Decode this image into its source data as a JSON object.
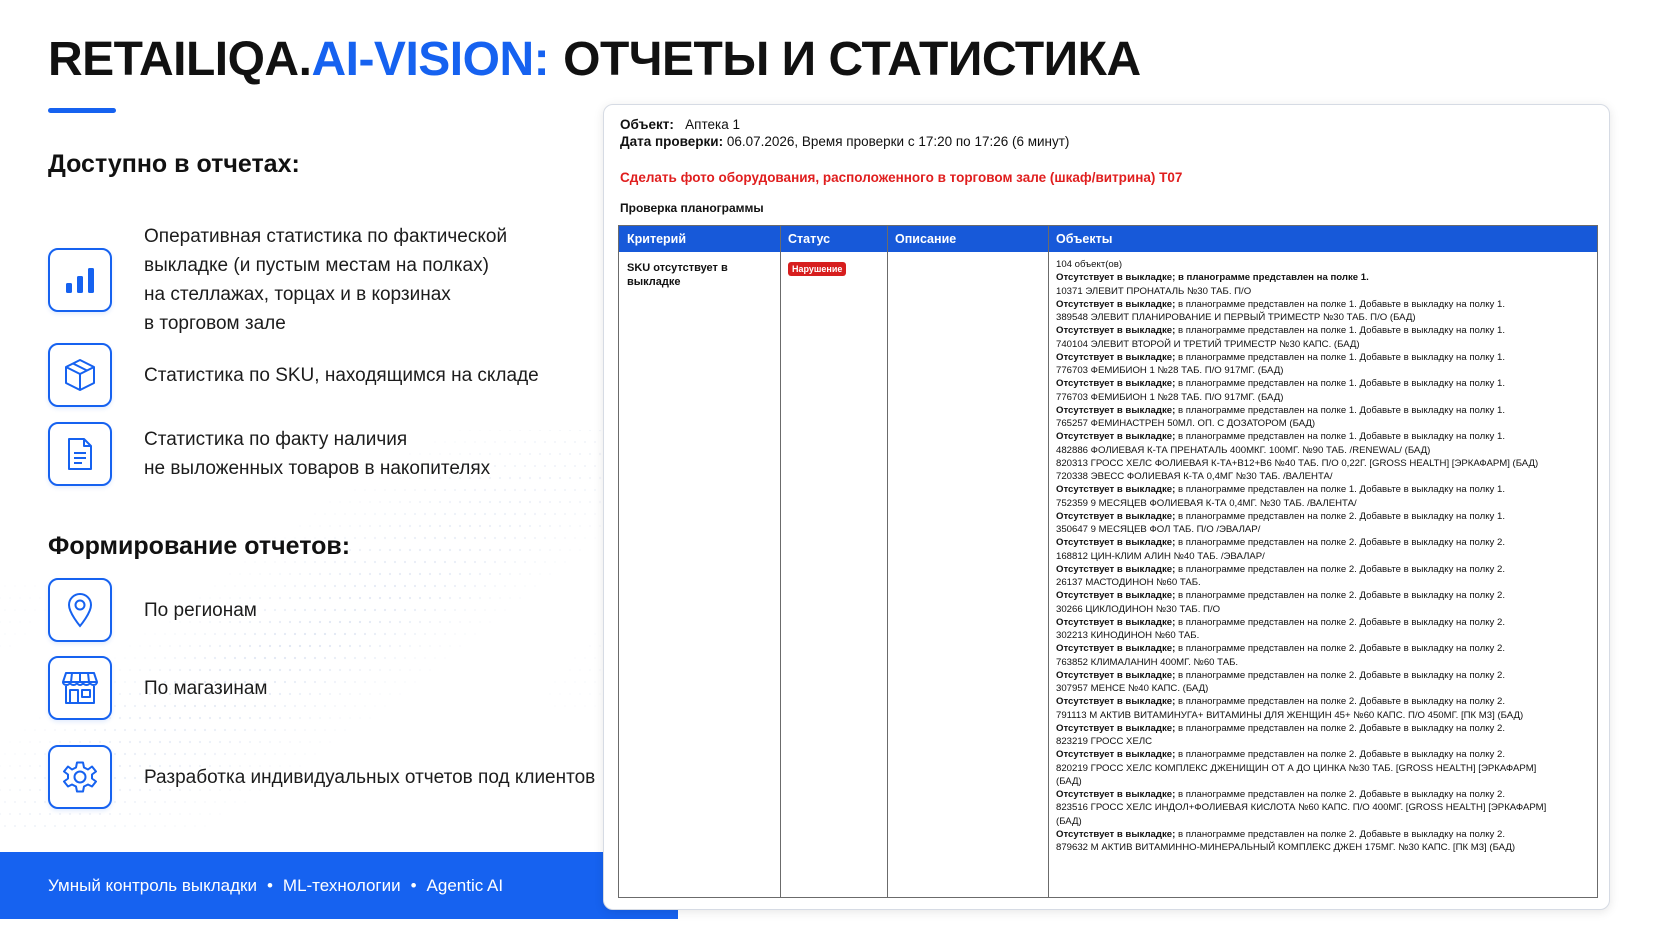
{
  "header": {
    "brand": "RETAILIQA.",
    "accent": "AI-VISION:",
    "rest": "ОТЧЕТЫ И СТАТИСТИКА"
  },
  "available": {
    "heading": "Доступно в отчетах:",
    "items": [
      {
        "icon": "bar-chart-icon",
        "lines": [
          "Оперативная статистика по фактической",
          "выкладке (и пустым местам на полках)",
          "на стеллажах, торцах и в корзинах",
          "в торговом зале"
        ]
      },
      {
        "icon": "box-icon",
        "lines": [
          "Статистика по SKU, находящимся на складе"
        ]
      },
      {
        "icon": "document-icon",
        "lines": [
          "Статистика по факту наличия",
          "не выложенных товаров в накопителях"
        ]
      }
    ]
  },
  "formation": {
    "heading": "Формирование отчетов:",
    "items": [
      {
        "icon": "location-pin-icon",
        "label": "По регионам"
      },
      {
        "icon": "store-icon",
        "label": "По магазинам"
      },
      {
        "icon": "gear-icon",
        "label": "Разработка индивидуальных отчетов под клиентов"
      }
    ]
  },
  "footer": {
    "items": [
      "Умный контроль выкладки",
      "ML-технологии",
      "Agentic AI"
    ],
    "separator": "•"
  },
  "report": {
    "object_label": "Объект:",
    "object_value": "Аптека 1",
    "date_label": "Дата проверки:",
    "date_value": "06.07.2026, Время проверки с 17:20 по 17:26 (6 минут)",
    "task": "Сделать фото оборудования, расположенного в торговом зале (шкаф/витрина) T07",
    "section": "Проверка планограммы",
    "columns": [
      "Критерий",
      "Статус",
      "Описание",
      "Объекты"
    ],
    "row": {
      "criterion": "SKU отсутствует в выкладке",
      "status": "Нарушение",
      "description": "",
      "objects_count": "104 объект(ов)",
      "objects": [
        [
          "Отсутствует в выкладке; в планограмме представлен на полке 1.",
          ""
        ],
        [
          "",
          "10371 ЭЛЕВИТ ПРОНАТАЛЬ №30 ТАБ. П/О"
        ],
        [
          "Отсутствует в выкладке;",
          " в планограмме представлен на полке 1. Добавьте в выкладку на полку 1."
        ],
        [
          "",
          "389548 ЭЛЕВИТ ПЛАНИРОВАНИЕ И ПЕРВЫЙ ТРИМЕСТР №30 ТАБ. П/О (БАД)"
        ],
        [
          "Отсутствует в выкладке;",
          " в планограмме представлен на полке 1. Добавьте в выкладку на полку 1."
        ],
        [
          "",
          "740104 ЭЛЕВИТ ВТОРОЙ И ТРЕТИЙ ТРИМЕСТР №30 КАПС. (БАД)"
        ],
        [
          "Отсутствует в выкладке;",
          " в планограмме представлен на полке 1. Добавьте в выкладку на полку 1."
        ],
        [
          "",
          "776703 ФЕМИБИОН 1 №28 ТАБ. П/О 917МГ. (БАД)"
        ],
        [
          "Отсутствует в выкладке;",
          " в планограмме представлен на полке 1. Добавьте в выкладку на полку 1."
        ],
        [
          "",
          "776703 ФЕМИБИОН 1 №28 ТАБ. П/О 917МГ. (БАД)"
        ],
        [
          "Отсутствует в выкладке;",
          " в планограмме представлен на полке 1. Добавьте в выкладку на полку 1."
        ],
        [
          "",
          "765257 ФЕМИНАСТРЕН 50МЛ. ОП. С ДОЗАТОРОМ (БАД)"
        ],
        [
          "Отсутствует в выкладке;",
          " в планограмме представлен на полке 1. Добавьте в выкладку на полку 1."
        ],
        [
          "",
          "482886 ФОЛИЕВАЯ К-ТА ПРЕНАТАЛЬ 400МКГ. 100МГ. №90 ТАБ. /RENEWAL/ (БАД)"
        ],
        [
          "",
          "820313 ГРОСС ХЕЛС ФОЛИЕВАЯ К-ТА+B12+B6 №40 ТАБ. П/О 0,22Г. [GROSS HEALTH] [ЭРКАФАРМ] (БАД)"
        ],
        [
          "",
          "720338 ЭВЕСС ФОЛИЕВАЯ К-ТА 0,4МГ №30 ТАБ. /ВАЛЕНТА/"
        ],
        [
          "Отсутствует в выкладке;",
          " в планограмме представлен на полке 1. Добавьте в выкладку на полку 1."
        ],
        [
          "",
          "752359 9 МЕСЯЦЕВ ФОЛИЕВАЯ К-ТА 0,4МГ. №30 ТАБ. /ВАЛЕНТА/"
        ],
        [
          "Отсутствует в выкладке;",
          " в планограмме представлен на полке 2. Добавьте в выкладку на полку 1."
        ],
        [
          "",
          "350647 9 МЕСЯЦЕВ ФОЛ ТАБ. П/О /ЭВАЛАР/"
        ],
        [
          "Отсутствует в выкладке;",
          " в планограмме представлен на полке 2. Добавьте в выкладку на полку 2."
        ],
        [
          "",
          "168812 ЦИН-КЛИМ АЛИН №40 ТАБ. /ЭВАЛАР/"
        ],
        [
          "Отсутствует в выкладке;",
          " в планограмме представлен на полке 2. Добавьте в выкладку на полку 2."
        ],
        [
          "",
          "26137 МАСТОДИНОН №60 ТАБ."
        ],
        [
          "Отсутствует в выкладке;",
          " в планограмме представлен на полке 2. Добавьте в выкладку на полку 2."
        ],
        [
          "",
          "30266 ЦИКЛОДИНОН №30 ТАБ. П/О"
        ],
        [
          "Отсутствует в выкладке;",
          " в планограмме представлен на полке 2. Добавьте в выкладку на полку 2."
        ],
        [
          "",
          "302213 КИНОДИНОН №60 ТАБ."
        ],
        [
          "Отсутствует в выкладке;",
          " в планограмме представлен на полке 2. Добавьте в выкладку на полку 2."
        ],
        [
          "",
          "763852 КЛИМАЛАНИН 400МГ. №60 ТАБ."
        ],
        [
          "Отсутствует в выкладке;",
          " в планограмме представлен на полке 2. Добавьте в выкладку на полку 2."
        ],
        [
          "",
          "307957 МЕНСЕ №40 КАПС. (БАД)"
        ],
        [
          "Отсутствует в выкладке;",
          " в планограмме представлен на полке 2. Добавьте в выкладку на полку 2."
        ],
        [
          "",
          "791113 М АКТИВ ВИТАМИНУГА+ ВИТАМИНЫ ДЛЯ ЖЕНЩИН 45+ №60 КАПС. П/О 450МГ. [ПК М3] (БАД)"
        ],
        [
          "Отсутствует в выкладке;",
          " в планограмме представлен на полке 2. Добавьте в выкладку на полку 2."
        ],
        [
          "",
          "823219 ГРОСС ХЕЛС"
        ],
        [
          "Отсутствует в выкладке;",
          " в планограмме представлен на полке 2. Добавьте в выкладку на полку 2."
        ],
        [
          "",
          "820219 ГРОСС ХЕЛС КОМПЛЕКС ДЖЕНИЩИН ОТ А ДО ЦИНКА №30 ТАБ. [GROSS HEALTH] [ЭРКАФАРМ]"
        ],
        [
          "",
          "(БАД)"
        ],
        [
          "Отсутствует в выкладке;",
          " в планограмме представлен на полке 2. Добавьте в выкладку на полку 2."
        ],
        [
          "",
          "823516 ГРОСС ХЕЛС ИНДОЛ+ФОЛИЕВАЯ КИСЛОТА №60 КАПС. П/О 400МГ. [GROSS HEALTH] [ЭРКАФАРМ]"
        ],
        [
          "",
          "(БАД)"
        ],
        [
          "Отсутствует в выкладке;",
          " в планограмме представлен на полке 2. Добавьте в выкладку на полку 2."
        ],
        [
          "",
          "879632 М АКТИВ ВИТАМИННО-МИНЕРАЛЬНЫЙ КОМПЛЕКС ДЖЕН 175МГ. №30 КАПС. [ПК М3] (БАД)"
        ]
      ]
    }
  },
  "colors": {
    "accent": "#1662f0",
    "table_header": "#1759d9",
    "alert_red": "#e01e1e",
    "badge_red": "#d71e1e"
  }
}
